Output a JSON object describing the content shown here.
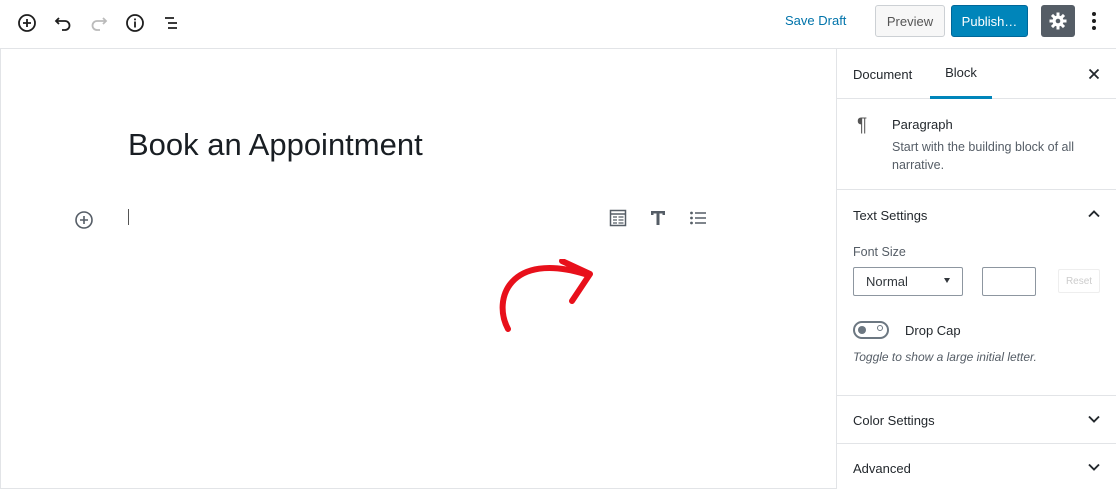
{
  "toolbar": {
    "save_draft": "Save Draft",
    "preview": "Preview",
    "publish": "Publish…"
  },
  "editor": {
    "title": "Book an Appointment"
  },
  "sidebar": {
    "tabs": [
      "Document",
      "Block"
    ],
    "active_tab": "Block",
    "block": {
      "name": "Paragraph",
      "description": "Start with the building block of all narrative."
    },
    "text_settings": {
      "heading": "Text Settings",
      "font_size_label": "Font Size",
      "font_size_value": "Normal",
      "custom_value": "",
      "reset_label": "Reset",
      "drop_cap_label": "Drop Cap",
      "drop_cap_help": "Toggle to show a large initial letter."
    },
    "color_settings": {
      "heading": "Color Settings"
    },
    "advanced": {
      "heading": "Advanced"
    }
  },
  "colors": {
    "accent": "#0085ba",
    "link": "#0073aa",
    "annotation_arrow": "#e8101b"
  }
}
